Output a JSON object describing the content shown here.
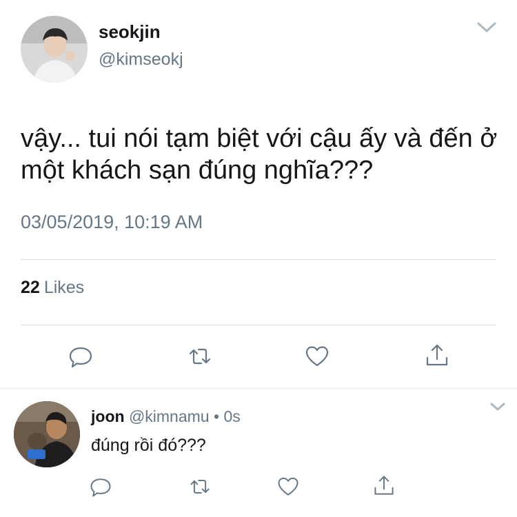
{
  "tweet": {
    "author": {
      "name": "seokjin",
      "handle": "@kimseokj",
      "avatar_icon": "profile-photo"
    },
    "text": "vậy... tui nói tạm biệt với cậu ấy và đến ở một khách sạn đúng nghĩa???",
    "timestamp": "03/05/2019, 10:19 AM",
    "likes": {
      "count": "22",
      "label": "Likes"
    },
    "actions": [
      "reply-icon",
      "retweet-icon",
      "like-icon",
      "share-icon"
    ],
    "menu_icon": "chevron-down-icon"
  },
  "reply": {
    "author": {
      "name": "joon",
      "handle": "@kimnamu",
      "separator": "•",
      "time": "0s",
      "avatar_icon": "profile-photo"
    },
    "text": "đúng rồi đó???",
    "actions": [
      "reply-icon",
      "retweet-icon",
      "like-icon",
      "share-icon"
    ],
    "menu_icon": "chevron-down-icon"
  },
  "colors": {
    "text_primary": "#14171a",
    "text_secondary": "#657786",
    "divider": "#d8dde1",
    "chevron": "#aab8c2"
  }
}
